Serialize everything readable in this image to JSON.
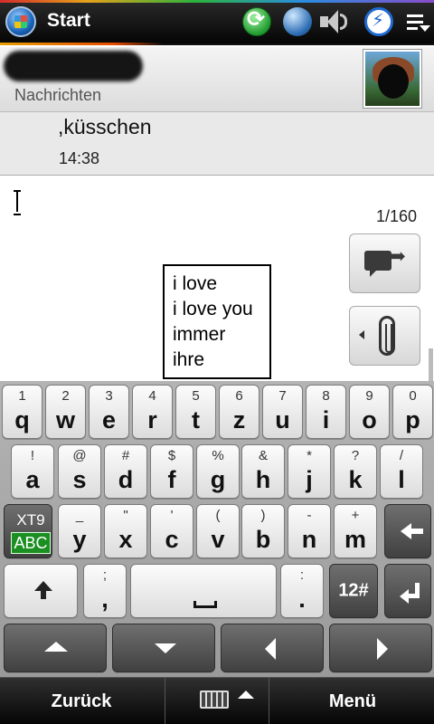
{
  "status_bar": {
    "title": "Start"
  },
  "contact": {
    "subtitle": "Nachrichten"
  },
  "message": {
    "text": ",küsschen",
    "time": "14:38"
  },
  "compose": {
    "char_count": "1/160"
  },
  "suggestions": [
    "i love",
    "i love you",
    "immer",
    "ihre"
  ],
  "keyboard": {
    "row1": [
      {
        "pri": "q",
        "sec": "1"
      },
      {
        "pri": "w",
        "sec": "2"
      },
      {
        "pri": "e",
        "sec": "3"
      },
      {
        "pri": "r",
        "sec": "4"
      },
      {
        "pri": "t",
        "sec": "5"
      },
      {
        "pri": "z",
        "sec": "6"
      },
      {
        "pri": "u",
        "sec": "7"
      },
      {
        "pri": "i",
        "sec": "8"
      },
      {
        "pri": "o",
        "sec": "9"
      },
      {
        "pri": "p",
        "sec": "0"
      }
    ],
    "row2": [
      {
        "pri": "a",
        "sec": "!"
      },
      {
        "pri": "s",
        "sec": "@"
      },
      {
        "pri": "d",
        "sec": "#"
      },
      {
        "pri": "f",
        "sec": "$"
      },
      {
        "pri": "g",
        "sec": "%"
      },
      {
        "pri": "h",
        "sec": "&"
      },
      {
        "pri": "j",
        "sec": "*"
      },
      {
        "pri": "k",
        "sec": "?"
      },
      {
        "pri": "l",
        "sec": "/"
      }
    ],
    "row3": [
      {
        "pri": "y",
        "sec": "_"
      },
      {
        "pri": "x",
        "sec": "\""
      },
      {
        "pri": "c",
        "sec": "'"
      },
      {
        "pri": "v",
        "sec": "("
      },
      {
        "pri": "b",
        "sec": ")"
      },
      {
        "pri": "n",
        "sec": "-"
      },
      {
        "pri": "m",
        "sec": "+"
      }
    ],
    "xt9_label": "XT9",
    "abc_label": "ABC",
    "comma": {
      "pri": ",",
      "sec": ";"
    },
    "period": {
      "pri": ".",
      "sec": ":"
    },
    "numsym_label": "12#"
  },
  "softkeys": {
    "left": "Zurück",
    "right": "Menü"
  }
}
